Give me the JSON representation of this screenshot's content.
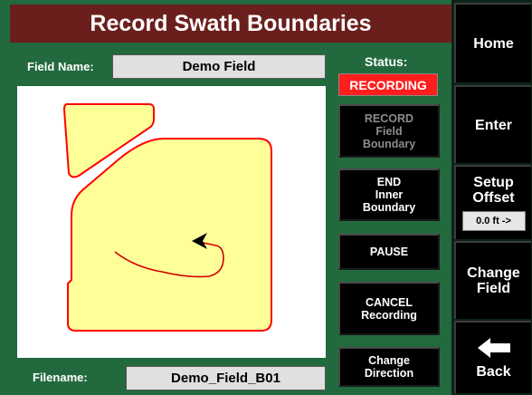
{
  "title": "Record Swath Boundaries",
  "field_name": {
    "label": "Field Name:",
    "value": "Demo Field"
  },
  "status": {
    "label": "Status:",
    "value": "RECORDING",
    "color": "#ff1d1d"
  },
  "filename": {
    "label": "Filename:",
    "value": "Demo_Field_B01"
  },
  "center_buttons": {
    "record": {
      "line1": "RECORD",
      "line2": "Field",
      "line3": "Boundary"
    },
    "end": {
      "line1": "END",
      "line2": "Inner",
      "line3": "Boundary"
    },
    "pause": {
      "line1": "PAUSE"
    },
    "cancel": {
      "line1": "CANCEL",
      "line2": "Recording"
    },
    "change_direction": {
      "line1": "Change",
      "line2": "Direction"
    }
  },
  "side_buttons": {
    "home": "Home",
    "enter": "Enter",
    "setup_offset": {
      "line1": "Setup",
      "line2": "Offset",
      "value": "0.0 ft ->"
    },
    "change_field": {
      "line1": "Change",
      "line2": "Field"
    },
    "back": "Back"
  },
  "map": {
    "boundary_color": "#ff0000",
    "fill_color": "#ffff99",
    "cursor_icon": "arrow-cursor-icon"
  },
  "colors": {
    "title_bg": "#6b1f1d",
    "panel_bg": "#226a3e"
  }
}
